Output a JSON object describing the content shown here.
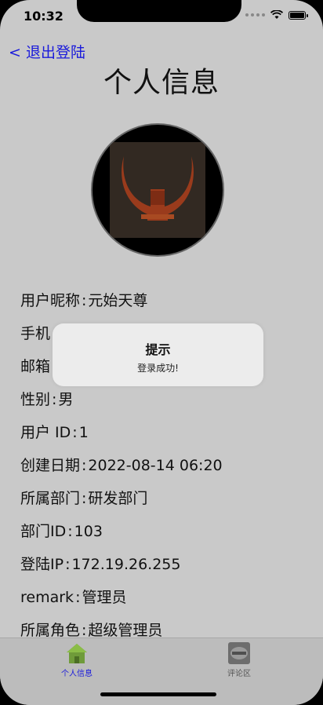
{
  "status_bar": {
    "time": "10:32"
  },
  "nav": {
    "back_label": "< 退出登陆",
    "title": "个人信息"
  },
  "profile": {
    "nickname": {
      "label": "用户昵称",
      "value": "元始天尊"
    },
    "phone": {
      "label": "手机"
    },
    "email": {
      "label": "邮箱"
    },
    "gender": {
      "label": "性别",
      "value": "男"
    },
    "user_id": {
      "label": "用户 ID",
      "value": "1"
    },
    "created": {
      "label": "创建日期",
      "value": "2022-08-14 06:20"
    },
    "department": {
      "label": "所属部门",
      "value": "研发部门"
    },
    "department_id": {
      "label": "部门ID",
      "value": "103"
    },
    "login_ip": {
      "label": "登陆IP",
      "value": "172.19.26.255"
    },
    "remark": {
      "label": "remark",
      "value": "管理员"
    },
    "role": {
      "label": "所属角色",
      "value": "超级管理员"
    }
  },
  "toast": {
    "title": "提示",
    "message": "登录成功!"
  },
  "tabbar": {
    "items": [
      {
        "label": "个人信息",
        "icon": "home-icon",
        "active": true
      },
      {
        "label": "评论区",
        "icon": "comment-area-icon",
        "active": false
      }
    ]
  },
  "colors": {
    "accent": "#1a1adb",
    "background": "#c9c9c9"
  }
}
